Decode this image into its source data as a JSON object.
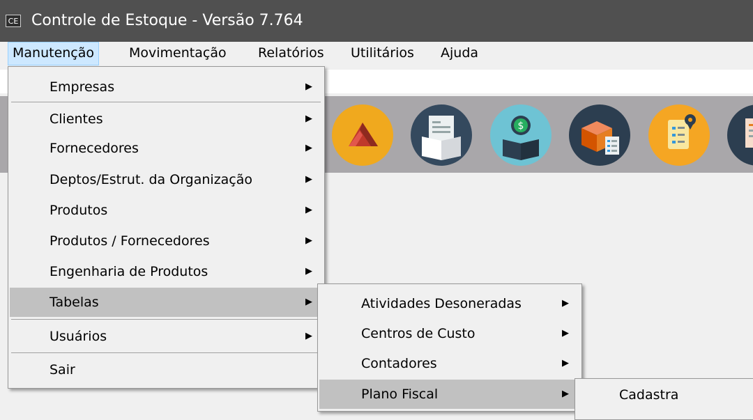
{
  "window": {
    "icon_text": "CE",
    "title": "Controle de Estoque - Versão 7.764"
  },
  "menubar": {
    "items": [
      {
        "label": "Manutenção",
        "active": true
      },
      {
        "label": "Movimentação"
      },
      {
        "label": "Relatórios"
      },
      {
        "label": "Utilitários"
      },
      {
        "label": "Ajuda"
      }
    ]
  },
  "toolbar": {
    "icons": [
      "sales-icon",
      "invoice-box-icon",
      "money-box-icon",
      "inventory-box-icon",
      "location-checklist-icon",
      "report-icon"
    ]
  },
  "menu_manutencao": {
    "items": [
      {
        "label": "Empresas",
        "arrow": "▶"
      },
      {
        "label": "Clientes",
        "arrow": "▶"
      },
      {
        "label": "Fornecedores",
        "arrow": "▶"
      },
      {
        "label": "Deptos/Estrut. da Organização",
        "arrow": "▶"
      },
      {
        "label": "Produtos",
        "arrow": "▶"
      },
      {
        "label": "Produtos / Fornecedores",
        "arrow": "▶"
      },
      {
        "label": "Engenharia de Produtos",
        "arrow": "▶"
      },
      {
        "label": "Tabelas",
        "arrow": "▶",
        "highlighted": true
      },
      {
        "label": "Usuários",
        "arrow": "▶"
      },
      {
        "label": "Sair"
      }
    ]
  },
  "menu_tabelas": {
    "items": [
      {
        "label": "Atividades Desoneradas",
        "arrow": "▶"
      },
      {
        "label": "Centros de Custo",
        "arrow": "▶"
      },
      {
        "label": "Contadores",
        "arrow": "▶"
      },
      {
        "label": "Plano Fiscal",
        "arrow": "▶",
        "highlighted": true
      }
    ]
  },
  "menu_plano_fiscal": {
    "items": [
      {
        "label": "Cadastra"
      }
    ]
  },
  "colors": {
    "titlebar": "#505050",
    "toolbar": "#a9a7aa",
    "menu_highlight": "#c1c1c1",
    "menubar_active": "#cde8ff"
  }
}
